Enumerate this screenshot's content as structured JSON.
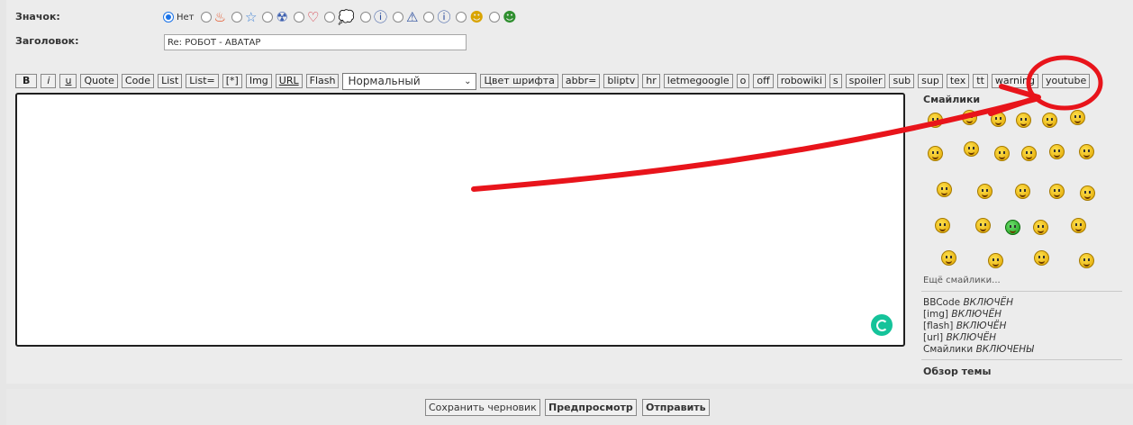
{
  "form": {
    "icon_label": "Значок:",
    "subject_label": "Заголовок:",
    "subject_value": "Re: РОБОТ - АВАТАР",
    "icon_none_label": "Нет",
    "icon_options": [
      "fire-icon",
      "star-icon",
      "radiation-icon",
      "heart-icon",
      "speech-bubble-icon",
      "question-icon",
      "warning-icon",
      "info-icon",
      "wink-smiley-icon",
      "grin-smiley-icon"
    ]
  },
  "toolbar": {
    "buttons": [
      "B",
      "i",
      "u",
      "Quote",
      "Code",
      "List",
      "List=",
      "[*]",
      "Img",
      "URL",
      "Flash"
    ],
    "size_select": "Нормальный",
    "buttons2": [
      "Цвет шрифта",
      "abbr=",
      "bliptv",
      "hr",
      "letmegoogle",
      "o",
      "off",
      "robowiki",
      "s",
      "spoiler",
      "sub",
      "sup",
      "tex",
      "tt",
      "warning",
      "youtube"
    ]
  },
  "editor": {
    "value": ""
  },
  "smilies": {
    "title": "Смайлики",
    "more": "Ещё смайлики..."
  },
  "status": {
    "bbcode": "BBCode",
    "bbcode_state": "ВКЛЮЧЁН",
    "img": "[img]",
    "img_state": "ВКЛЮЧЁН",
    "flash": "[flash]",
    "flash_state": "ВКЛЮЧЁН",
    "url": "[url]",
    "url_state": "ВКЛЮЧЁН",
    "smilies": "Смайлики",
    "smilies_state": "ВКЛЮЧЕНЫ"
  },
  "review": "Обзор темы",
  "actions": {
    "save_draft": "Сохранить черновик",
    "preview": "Предпросмотр",
    "submit": "Отправить"
  },
  "annotation": {
    "color": "#e8141b"
  }
}
